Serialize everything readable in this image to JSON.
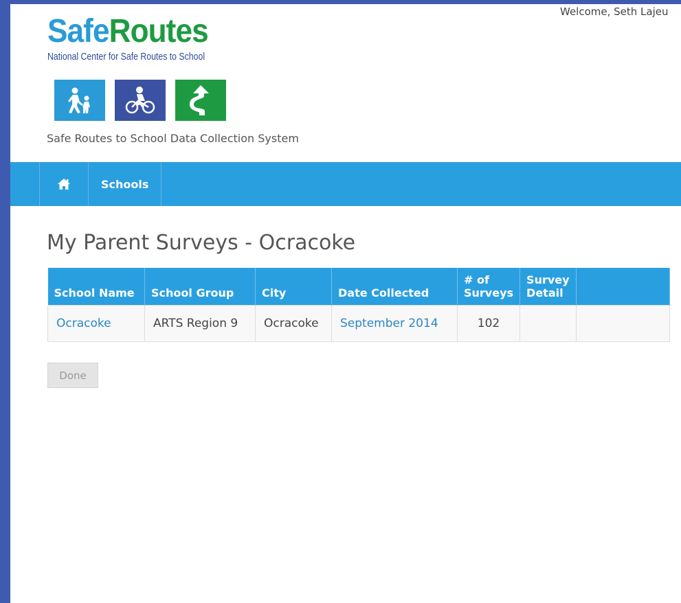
{
  "header": {
    "welcome": "Welcome, Seth Lajeu",
    "logo_safe": "Safe",
    "logo_routes": "Routes",
    "logo_subtitle": "National Center for Safe Routes to School",
    "tagline": "Safe Routes to School Data Collection System",
    "logo_icons": [
      "walking-icon",
      "biking-icon",
      "route-icon"
    ]
  },
  "nav": {
    "home_icon": "home-icon",
    "schools_label": "Schools"
  },
  "main": {
    "title": "My Parent Surveys - Ocracoke",
    "table": {
      "headers": [
        "School Name",
        "School Group",
        "City",
        "Date Collected",
        "# of Surveys",
        "Survey Detail",
        ""
      ],
      "rows": [
        [
          "Ocracoke",
          "ARTS Region 9",
          "Ocracoke",
          "September 2014",
          "102",
          "",
          ""
        ]
      ]
    },
    "done_label": "Done"
  },
  "colors": {
    "brand_blue": "#2a9fe0",
    "brand_green": "#1e9b42",
    "brand_navy": "#3b52a3",
    "link": "#2a86c8"
  }
}
